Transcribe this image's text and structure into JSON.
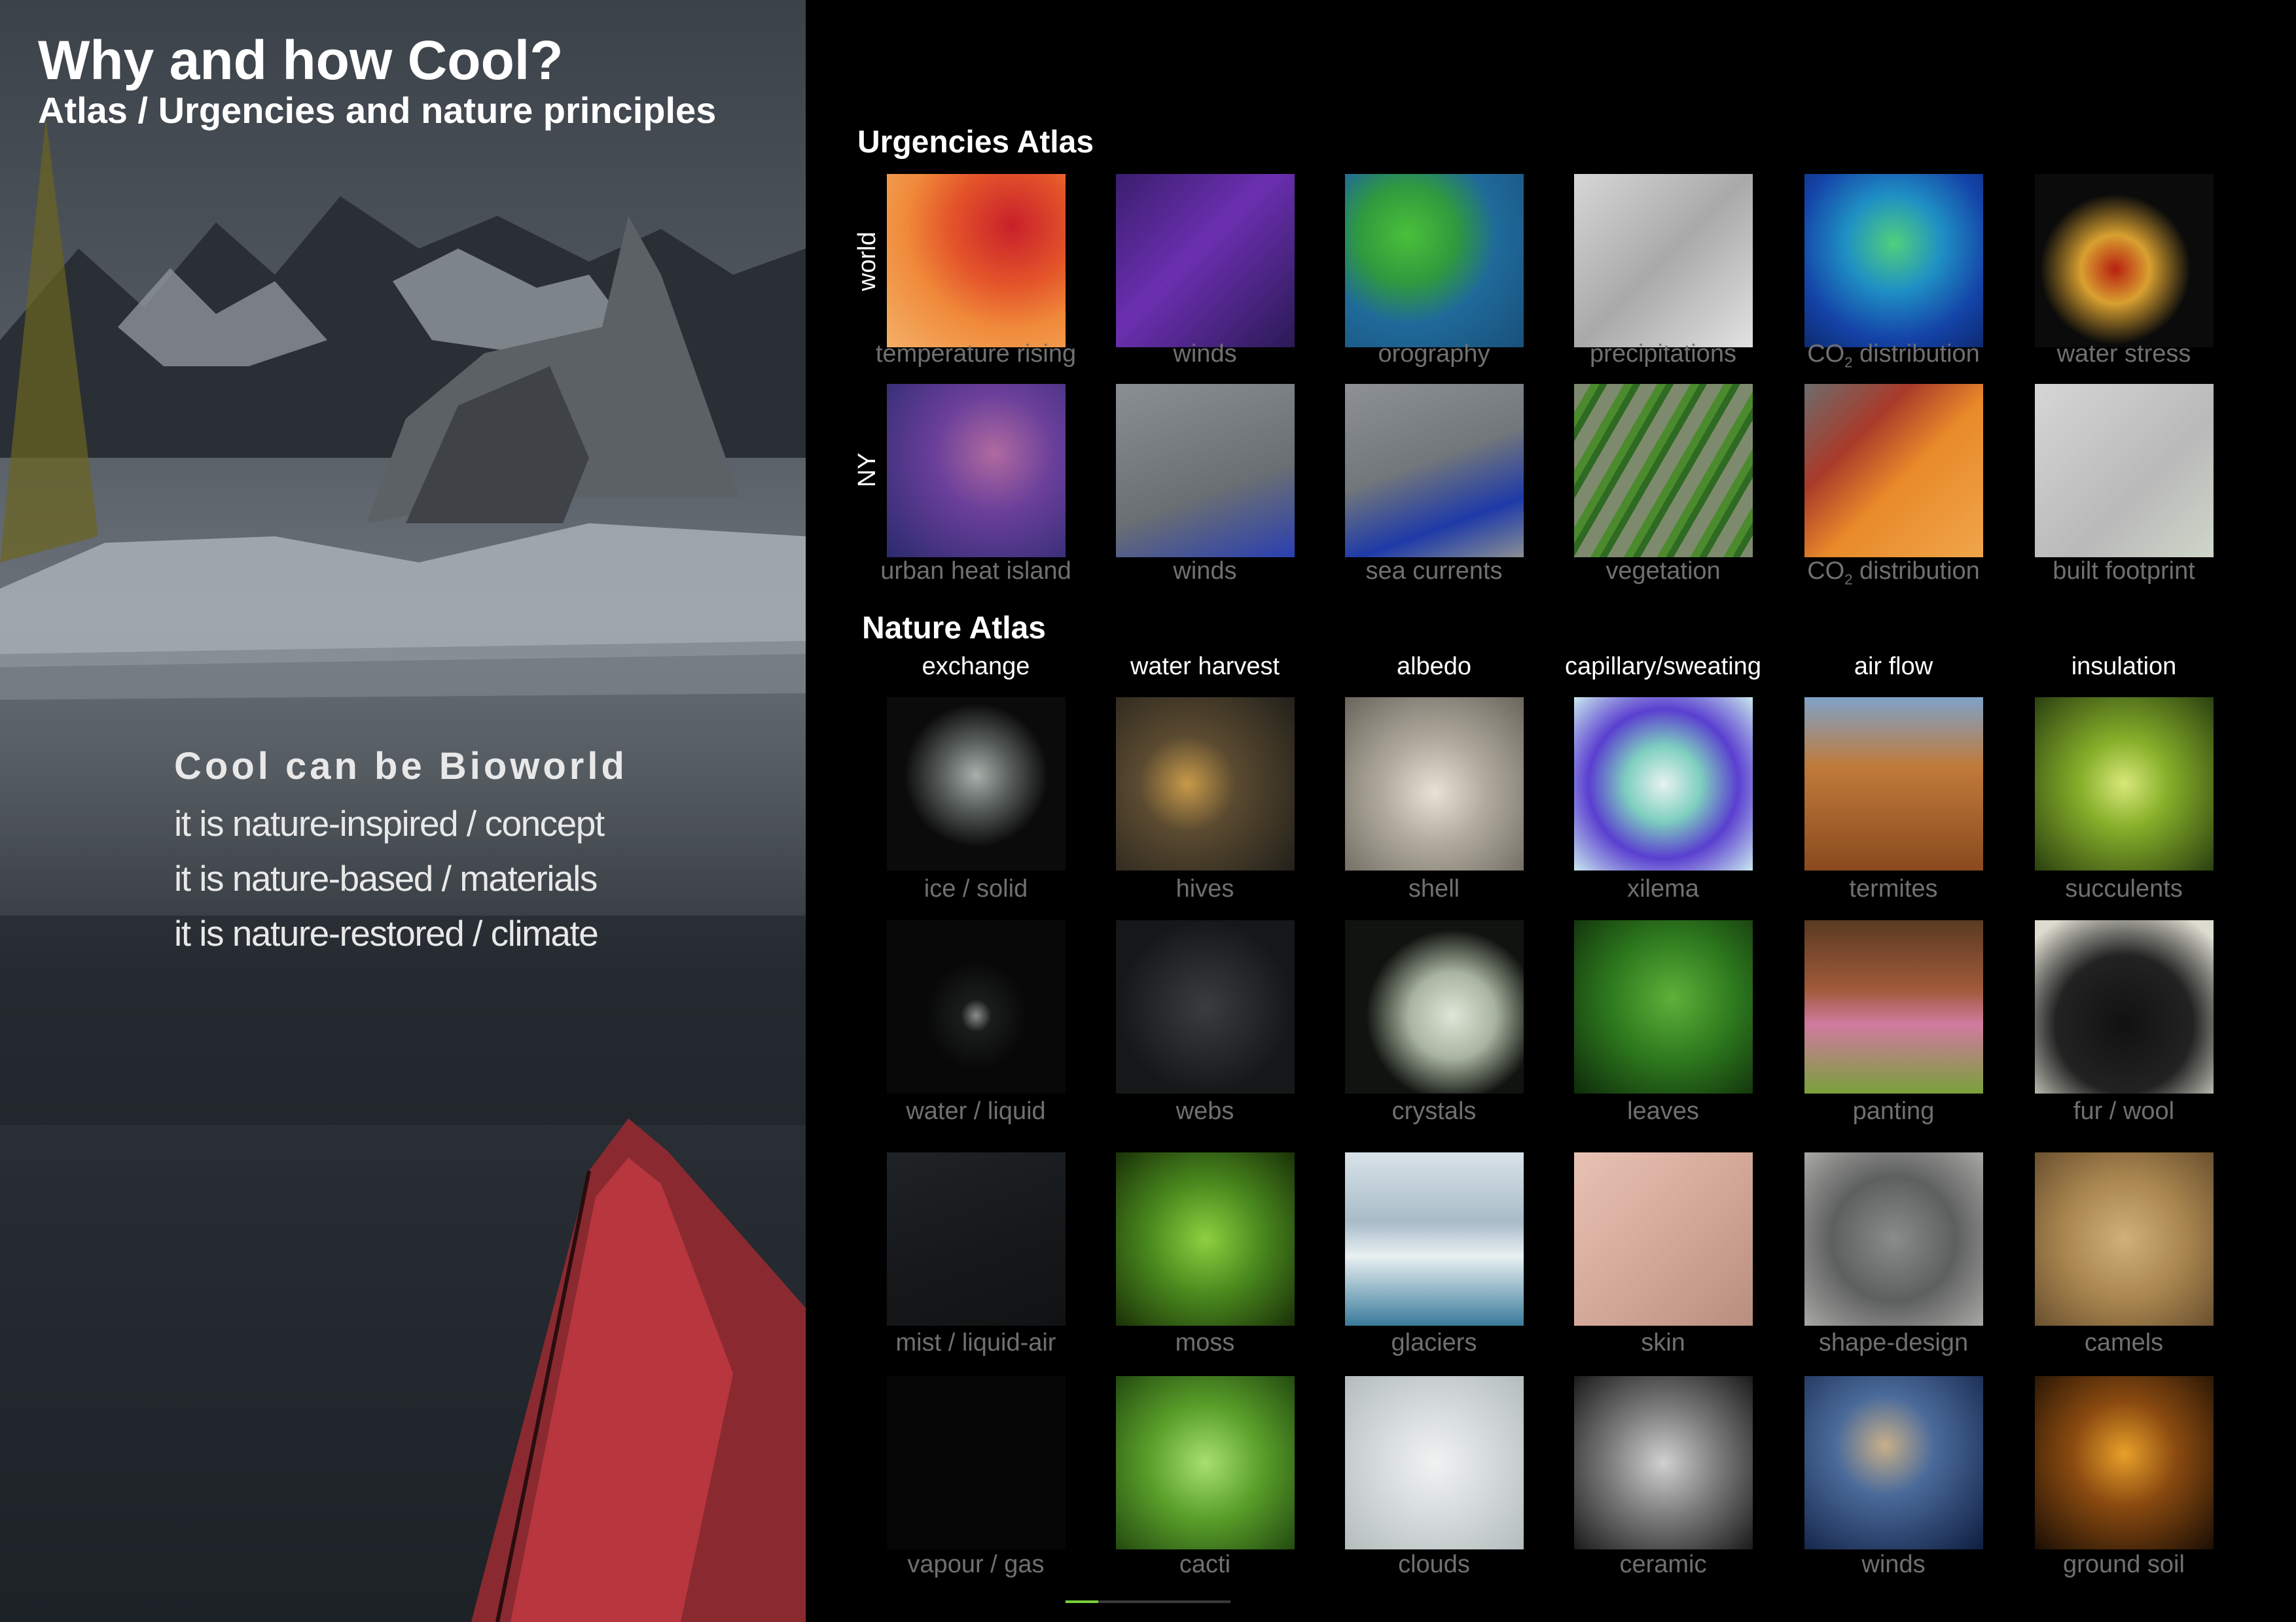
{
  "header": {
    "title": "Why and how Cool?",
    "subtitle": "Atlas / Urgencies and nature principles"
  },
  "slogan": {
    "head": "Cool can be Bioworld",
    "lines": [
      "it is nature-inspired / concept",
      "it is nature-based / materials",
      "it is nature-restored / climate"
    ]
  },
  "urgencies": {
    "title": "Urgencies Atlas",
    "rows": [
      {
        "label": "world",
        "items": [
          {
            "caption": "temperature rising"
          },
          {
            "caption": "winds"
          },
          {
            "caption": "orography"
          },
          {
            "caption": "precipitations"
          },
          {
            "caption": "CO",
            "sub": "2",
            "tail": " distribution"
          },
          {
            "caption": "water stress"
          }
        ]
      },
      {
        "label": "NY",
        "items": [
          {
            "caption": "urban heat island"
          },
          {
            "caption": "winds"
          },
          {
            "caption": "sea currents"
          },
          {
            "caption": "vegetation"
          },
          {
            "caption": "CO",
            "sub": "2",
            "tail": " distribution"
          },
          {
            "caption": "built footprint"
          }
        ]
      }
    ]
  },
  "nature": {
    "title": "Nature Atlas",
    "columns": [
      "exchange",
      "water harvest",
      "albedo",
      "capillary/sweating",
      "air flow",
      "insulation"
    ],
    "rows": [
      [
        "ice / solid",
        "hives",
        "shell",
        "xilema",
        "termites",
        "succulents"
      ],
      [
        "water / liquid",
        "webs",
        "crystals",
        "leaves",
        "panting",
        "fur / wool"
      ],
      [
        "mist / liquid-air",
        "moss",
        "glaciers",
        "skin",
        "shape-design",
        "camels"
      ],
      [
        "vapour / gas",
        "cacti",
        "clouds",
        "ceramic",
        "winds",
        "ground soil"
      ]
    ]
  },
  "pager": {
    "progress": 0.2
  },
  "colors": {
    "accent": "#7bcf3a",
    "caption": "#707070",
    "background": "#000000"
  }
}
